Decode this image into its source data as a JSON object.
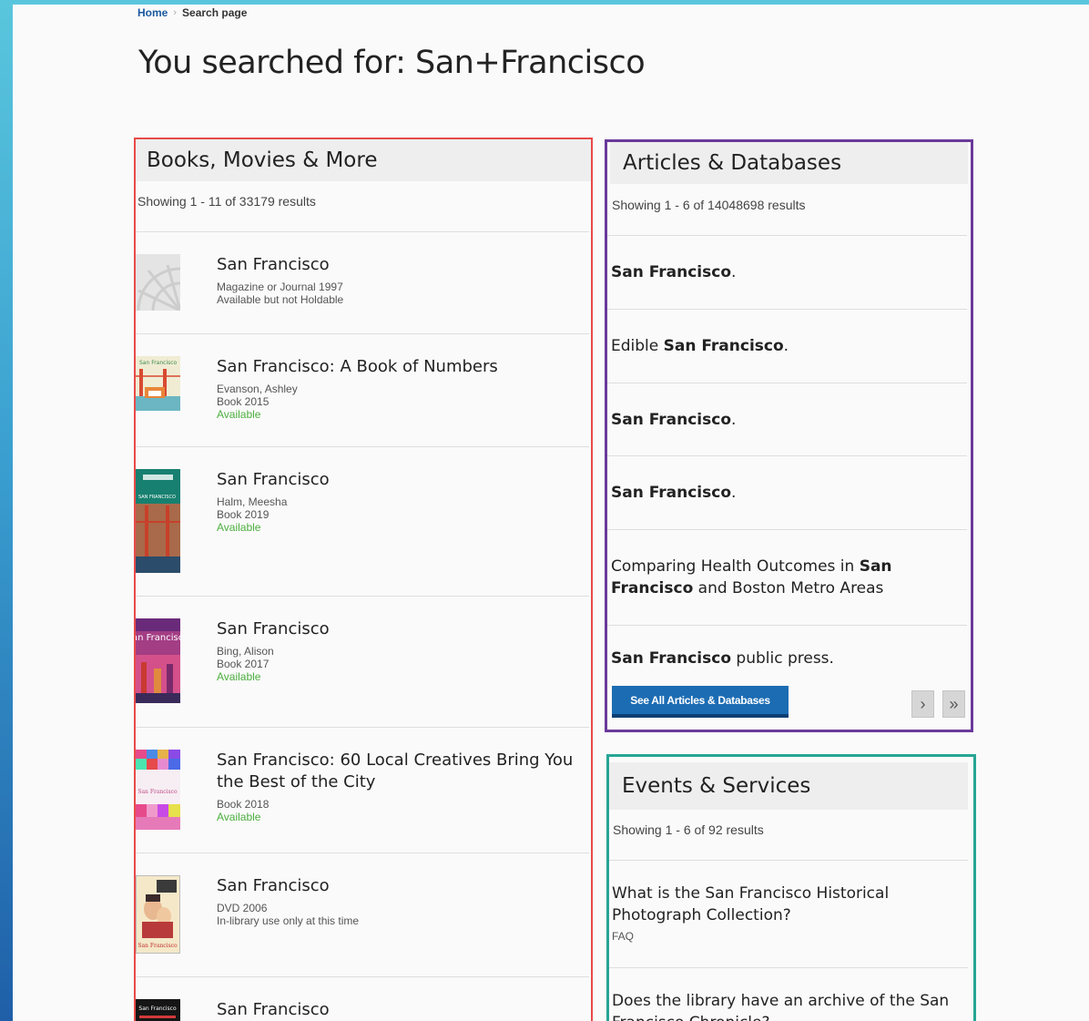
{
  "breadcrumb": {
    "home": "Home",
    "separator": "›",
    "current": "Search page"
  },
  "page_title": "You searched for: San+Francisco",
  "books": {
    "header": "Books, Movies & More",
    "count": "Showing 1 - 11 of 33179 results",
    "items": [
      {
        "title": "San Francisco",
        "meta1": "Magazine or Journal 1997",
        "meta2": "Available but not Holdable",
        "meta3": ""
      },
      {
        "title": "San Francisco: A Book of Numbers",
        "meta1": "Evanson, Ashley",
        "meta2": "Book 2015",
        "meta3": "Available"
      },
      {
        "title": "San Francisco",
        "meta1": "Halm, Meesha",
        "meta2": "Book 2019",
        "meta3": "Available"
      },
      {
        "title": "San Francisco",
        "meta1": "Bing, Alison",
        "meta2": "Book 2017",
        "meta3": "Available"
      },
      {
        "title": "San Francisco: 60 Local Creatives Bring You the Best of the City",
        "meta1": "Book 2018",
        "meta2": "Available",
        "meta3": ""
      },
      {
        "title": "San Francisco",
        "meta1": "DVD 2006",
        "meta2": "In-library use only at this time",
        "meta3": ""
      },
      {
        "title": "San Francisco",
        "meta1": "",
        "meta2": "",
        "meta3": ""
      }
    ],
    "covers": [
      {
        "label": ""
      },
      {
        "label": "San Francisco"
      },
      {
        "label": "SAN FRANCISCO"
      },
      {
        "label": "San Francisco"
      },
      {
        "label": "San Francisco"
      },
      {
        "label": "San Francisco"
      },
      {
        "label": "San Francisco"
      }
    ]
  },
  "articles": {
    "header": "Articles & Databases",
    "count": "Showing 1 - 6 of 14048698 results",
    "items": [
      {
        "pre": "",
        "bold": "San Francisco",
        "post": "."
      },
      {
        "pre": "Edible ",
        "bold": "San Francisco",
        "post": "."
      },
      {
        "pre": "",
        "bold": "San Francisco",
        "post": "."
      },
      {
        "pre": "",
        "bold": "San Francisco",
        "post": "."
      },
      {
        "pre": "Comparing Health Outcomes in ",
        "bold": "San Francisco",
        "post": " and Boston Metro Areas"
      },
      {
        "pre": "",
        "bold": "San Francisco",
        "post": " public press."
      }
    ],
    "see_all": "See All Articles & Databases",
    "next": "›",
    "last": "»"
  },
  "events": {
    "header": "Events & Services",
    "count": "Showing 1 - 6 of 92 results",
    "items": [
      {
        "title": "What is the San Francisco Historical Photograph Collection?",
        "type": "FAQ"
      },
      {
        "title": "Does the library have an archive of the San Francisco Chronicle?",
        "type": ""
      }
    ]
  },
  "colors": {
    "books_border": "#e94a4a",
    "articles_border": "#6a3a9a",
    "events_border": "#26a594",
    "available": "#4caf3f",
    "button": "#1c6cb3"
  }
}
